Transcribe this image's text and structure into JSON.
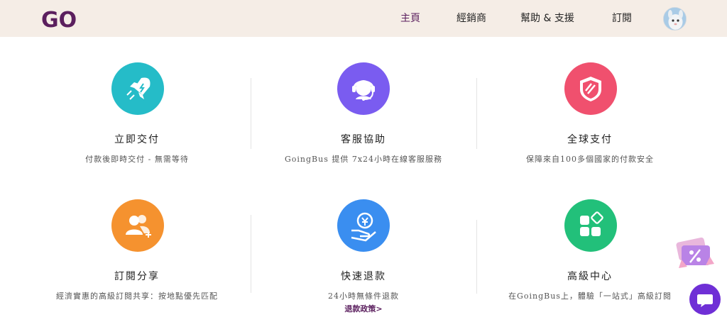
{
  "header": {
    "logo_text": "GO",
    "nav": [
      {
        "label": "主頁"
      },
      {
        "label": "經銷商"
      },
      {
        "label": "幫助 & 支援"
      },
      {
        "label": "訂閱"
      }
    ]
  },
  "features": [
    {
      "title": "立即交付",
      "desc": "付款後即時交付 - 無需等待",
      "color": "#25bcc8",
      "icon": "rocket-icon"
    },
    {
      "title": "客服協助",
      "desc": "GoingBus 提供 7x24小時在線客服服務",
      "color": "#7a5cf0",
      "icon": "headset-icon"
    },
    {
      "title": "全球支付",
      "desc": "保障來自100多個國家的付款安全",
      "color": "#f0506e",
      "icon": "shield-icon"
    },
    {
      "title": "訂閱分享",
      "desc": "經濟實惠的高級訂閱共享：按地點優先匹配",
      "color": "#f5922f",
      "icon": "users-icon"
    },
    {
      "title": "快速退款",
      "desc": "24小時無條件退款",
      "color": "#3a8ef0",
      "icon": "refund-icon",
      "link": "退款政策>"
    },
    {
      "title": "高級中心",
      "desc": "在GoingBus上，體驗「一站式」高級訂閱",
      "color": "#22c07a",
      "icon": "apps-icon"
    }
  ],
  "colors": {
    "header_bg": "#f5ede6",
    "brand": "#5b1f5e",
    "chat": "#6f2fd6"
  }
}
